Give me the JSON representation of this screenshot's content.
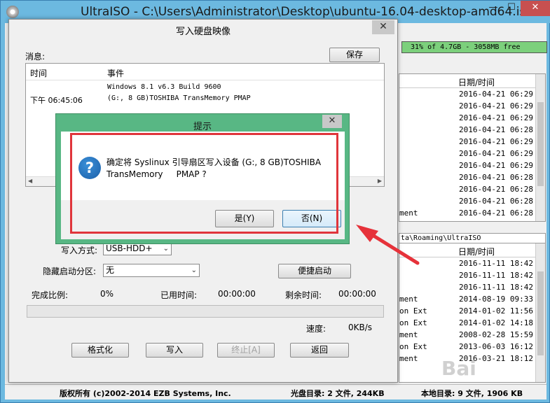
{
  "main": {
    "title": "UltraISO - C:\\Users\\Administrator\\Desktop\\ubuntu-16.04-desktop-amd64.iso",
    "capacity": "31% of 4.7GB - 3058MB free",
    "top_panel": {
      "date_header": "日期/时间",
      "rows": [
        {
          "date": "2016-04-21 06:29"
        },
        {
          "date": "2016-04-21 06:29"
        },
        {
          "date": "2016-04-21 06:29"
        },
        {
          "date": "2016-04-21 06:28"
        },
        {
          "date": "2016-04-21 06:29"
        },
        {
          "date": "2016-04-21 06:29"
        },
        {
          "date": "2016-04-21 06:29"
        },
        {
          "date": "2016-04-21 06:28"
        },
        {
          "date": "2016-04-21 06:28"
        },
        {
          "date": "2016-04-21 06:28"
        },
        {
          "name": "ment",
          "date": "2016-04-21 06:28"
        }
      ]
    },
    "path": "ta\\Roaming\\UltraISO",
    "bottom_panel": {
      "date_header": "日期/时间",
      "rows": [
        {
          "date": "2016-11-11 18:42"
        },
        {
          "date": "2016-11-11 18:42"
        },
        {
          "date": "2016-11-11 18:42"
        },
        {
          "name": "ment",
          "date": "2014-08-19 09:33"
        },
        {
          "name": "on Ext",
          "date": "2014-01-02 11:56"
        },
        {
          "name": "on Ext",
          "date": "2014-01-02 14:18"
        },
        {
          "name": "ment",
          "date": "2008-02-28 15:59"
        },
        {
          "name": "on Ext",
          "date": "2013-06-03 16:12"
        },
        {
          "name": "ment",
          "date": "2016-03-21 18:12"
        }
      ]
    },
    "status": {
      "copyright": "版权所有 (c)2002-2014 EZB Systems, Inc.",
      "cd": "光盘目录: 2 文件, 244KB",
      "local": "本地目录: 9 文件, 1906 KB"
    }
  },
  "write_dialog": {
    "title": "写入硬盘映像",
    "messages_label": "消息:",
    "save_label": "保存",
    "log_headers": {
      "time": "时间",
      "event": "事件"
    },
    "log": {
      "time": "下午 06:45:06",
      "event_line1": "Windows 8.1 v6.3 Build 9600",
      "event_line2": "(G:, 8 GB)TOSHIBA TransMemory     PMAP"
    },
    "write_method_label": "写入方式:",
    "write_method_value": "USB-HDD+",
    "hide_partition_label": "隐藏启动分区:",
    "hide_partition_value": "无",
    "boot_button_label": "便捷启动",
    "progress_label": "完成比例:",
    "progress_value": "0%",
    "progress_fraction": 0,
    "elapsed_label": "已用时间:",
    "elapsed_value": "00:00:00",
    "remaining_label": "剩余时间:",
    "remaining_value": "00:00:00",
    "speed_label": "速度:",
    "speed_value": "0KB/s",
    "buttons": {
      "format": "格式化",
      "write": "写入",
      "stop": "终止[A]",
      "return": "返回"
    }
  },
  "confirm_dialog": {
    "title": "提示",
    "message": "确定将 Syslinux 引导扇区写入设备 (G:, 8 GB)TOSHIBA\nTransMemory     PMAP ?",
    "yes_label": "是(Y)",
    "no_label": "否(N)"
  },
  "watermark": "Bai"
}
